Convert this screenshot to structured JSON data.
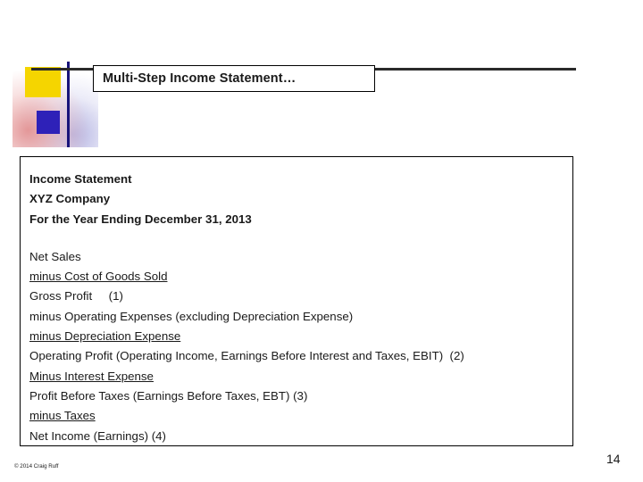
{
  "slide": {
    "title": "Multi-Step Income Statement…",
    "page_number": "14",
    "copyright": "© 2014 Craig Ruff"
  },
  "content": {
    "header_lines": [
      "Income Statement",
      "XYZ Company",
      "For the Year Ending December 31, 2013"
    ],
    "body_lines": [
      {
        "text": "Net Sales",
        "underline": false
      },
      {
        "text": "minus Cost of Goods Sold",
        "underline": true
      },
      {
        "text": "Gross Profit     (1)",
        "underline": false
      },
      {
        "text": "minus Operating Expenses (excluding Depreciation Expense)",
        "underline": false
      },
      {
        "text": "minus Depreciation Expense",
        "underline": true
      },
      {
        "text": "Operating Profit (Operating Income, Earnings Before Interest and Taxes, EBIT)  (2)",
        "underline": false
      },
      {
        "text": "Minus Interest Expense",
        "underline": true
      },
      {
        "text": "Profit Before Taxes (Earnings Before Taxes, EBT) (3)",
        "underline": false
      },
      {
        "text": "minus Taxes",
        "underline": true
      },
      {
        "text": "Net Income (Earnings) (4)",
        "underline": false
      }
    ]
  }
}
